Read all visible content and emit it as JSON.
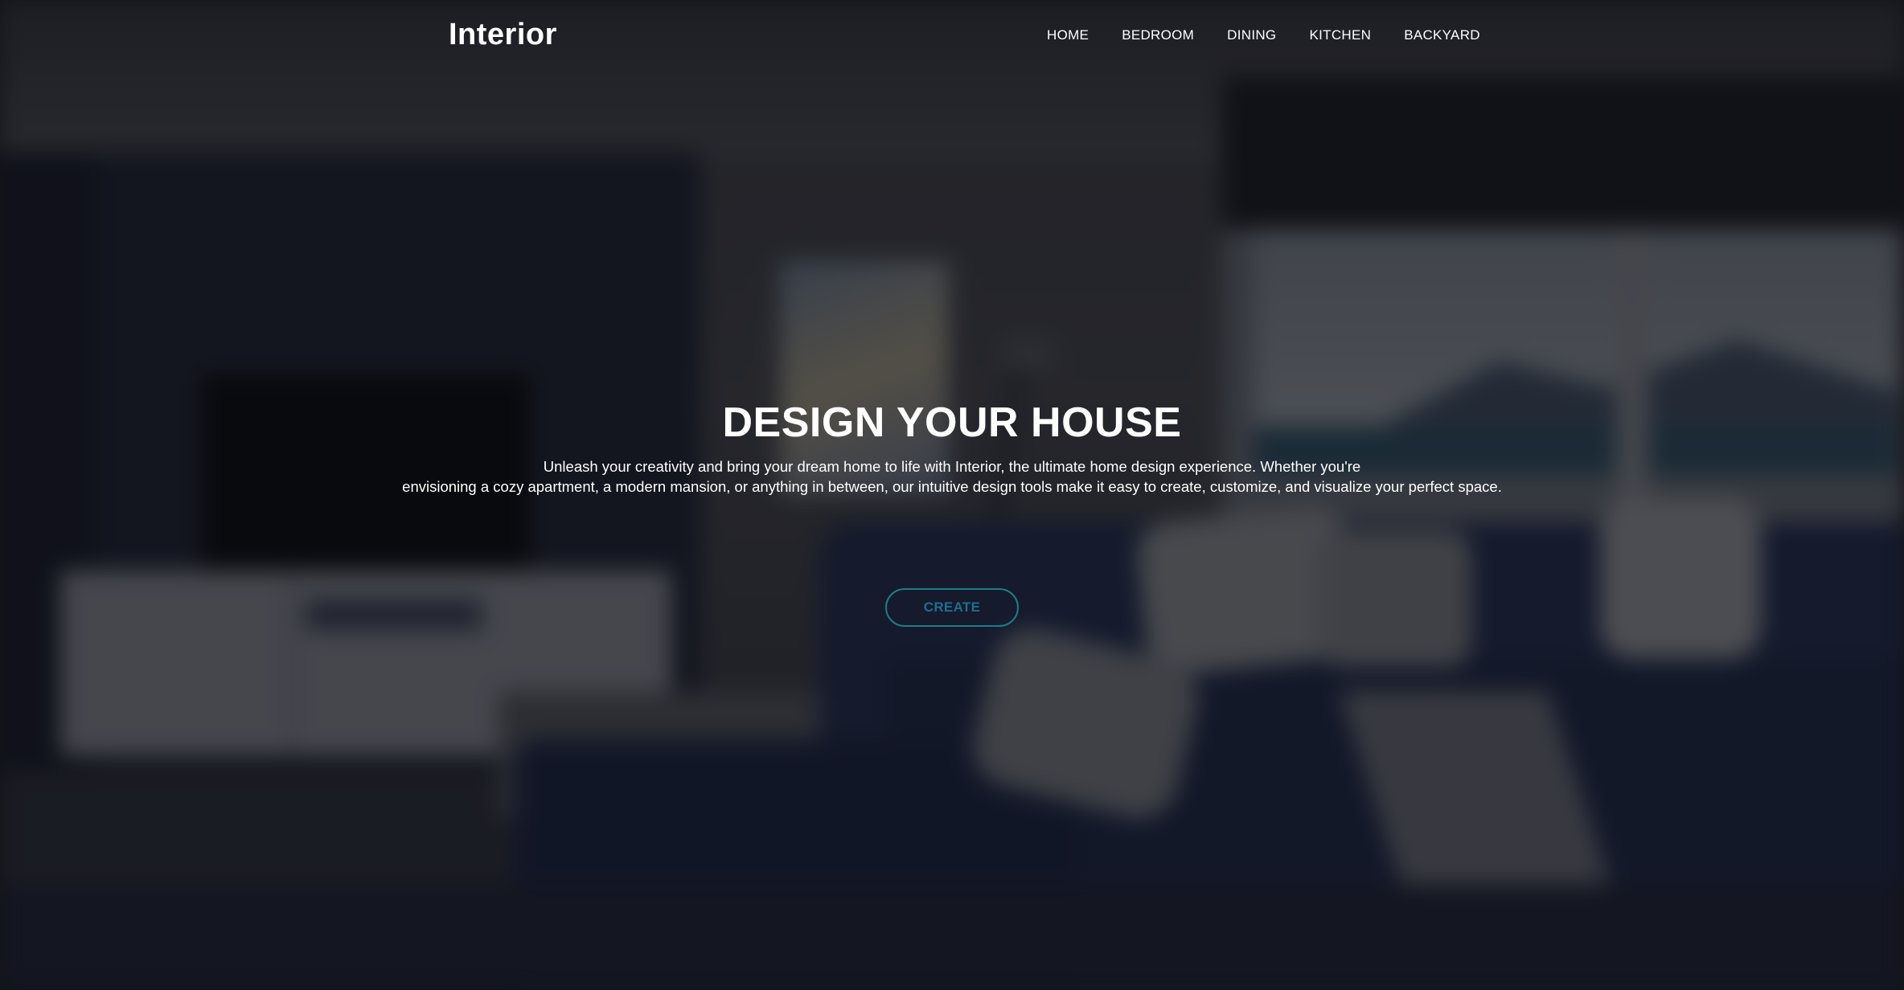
{
  "brand": {
    "logo_text": "Interior"
  },
  "nav": {
    "items": [
      {
        "label": "HOME"
      },
      {
        "label": "BEDROOM"
      },
      {
        "label": "DINING"
      },
      {
        "label": "KITCHEN"
      },
      {
        "label": "BACKYARD"
      }
    ]
  },
  "hero": {
    "headline": "DESIGN YOUR HOUSE",
    "description_line1": "Unleash your creativity and bring your dream home to life with Interior, the ultimate home design experience. Whether you're",
    "description_line2": "envisioning a cozy apartment, a modern mansion, or anything in between, our intuitive design tools make it easy to create, customize, and visualize your perfect space.",
    "cta_label": "CREATE"
  },
  "colors": {
    "overlay": "#0c0d12",
    "cta_border": "#1c7d88",
    "cta_text": "#1d6f8e",
    "text": "#ffffff"
  }
}
